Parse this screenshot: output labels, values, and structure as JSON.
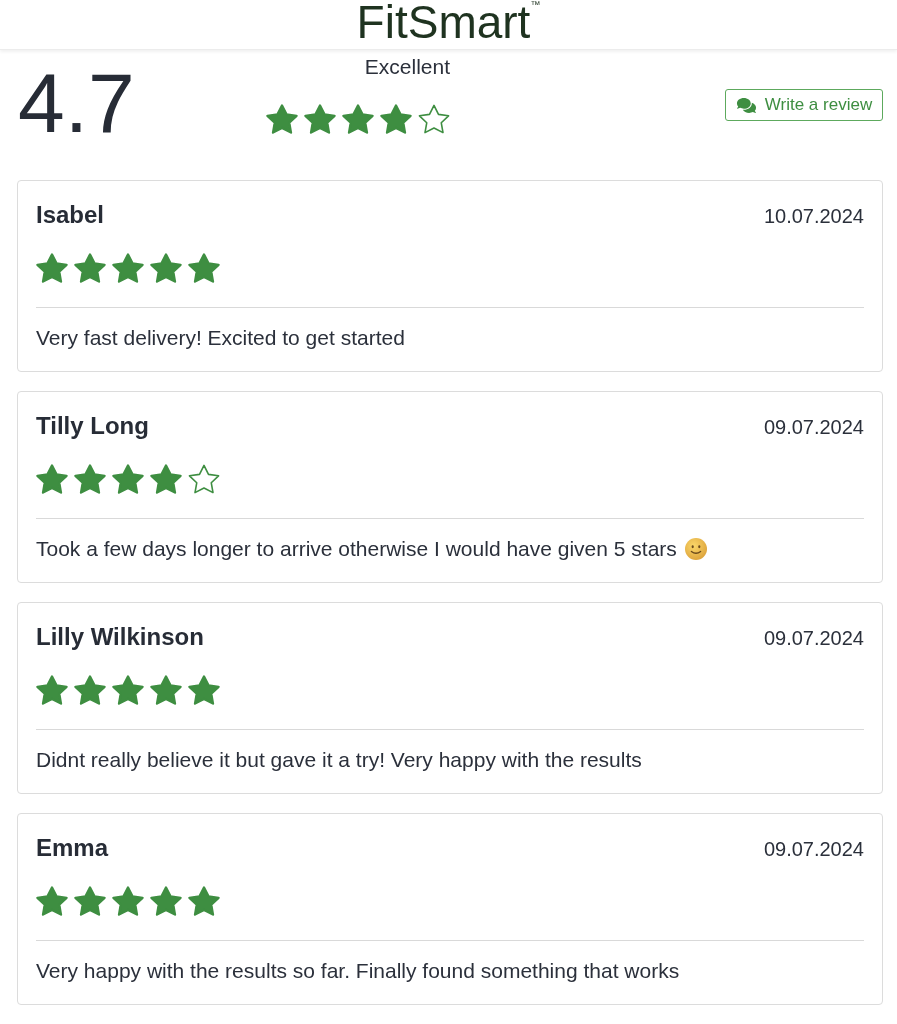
{
  "header": {
    "logo": "FitSmart$^{™}$"
  },
  "summary": {
    "score": "4.7",
    "label": "Excellent",
    "stars": 4,
    "button": "Write a review"
  },
  "reviews": [
    {
      "name": "Isabel",
      "date": "10.07.2024",
      "stars": 5,
      "text": "Very fast delivery! Excited to get started",
      "trailing_emoji": false
    },
    {
      "name": "Tilly Long",
      "date": "09.07.2024",
      "stars": 4,
      "text": "Took a few days longer to arrive otherwise I would have given 5 stars",
      "trailing_emoji": true
    },
    {
      "name": "Lilly Wilkinson",
      "date": "09.07.2024",
      "stars": 5,
      "text": "Didnt really believe it but gave it a try! Very happy with the results",
      "trailing_emoji": false
    },
    {
      "name": "Emma",
      "date": "09.07.2024",
      "stars": 5,
      "text": "Very happy with the results so far. Finally found something that works",
      "trailing_emoji": false
    }
  ]
}
